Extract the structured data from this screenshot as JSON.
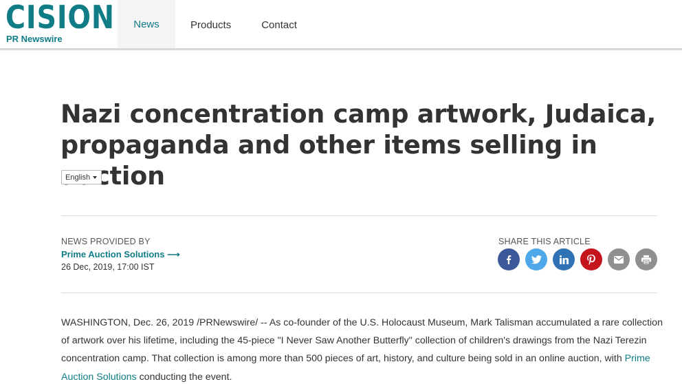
{
  "header": {
    "logo": {
      "word": "CISION",
      "registered": "®",
      "sub": "PR Newswire"
    },
    "nav": [
      {
        "label": "News",
        "active": true
      },
      {
        "label": "Products",
        "active": false
      },
      {
        "label": "Contact",
        "active": false
      }
    ]
  },
  "article": {
    "title": "Nazi concentration camp artwork, Judaica, propaganda and other items selling in auction",
    "language": "English",
    "provided_label": "NEWS PROVIDED BY",
    "provider": "Prime Auction Solutions",
    "provider_arrow": "⟶",
    "date": "26 Dec, 2019, 17:00 IST",
    "body_before": "WASHINGTON, Dec. 26, 2019 /PRNewswire/ -- As co-founder of the U.S. Holocaust Museum, Mark Talisman accumulated a rare collection of artwork over his lifetime, including the 45-piece \"I Never Saw Another Butterfly\" collection of children's drawings from the Nazi Terezin concentration camp. That collection is among more than 500 pieces of art, history, and culture being sold in an online auction, with ",
    "body_link": "Prime Auction Solutions",
    "body_after": " conducting the event."
  },
  "share": {
    "label": "SHARE THIS ARTICLE",
    "buttons": [
      {
        "icon": "facebook-icon",
        "color": "#3b5998"
      },
      {
        "icon": "twitter-icon",
        "color": "#4da7e8"
      },
      {
        "icon": "linkedin-icon",
        "color": "#2f73b4"
      },
      {
        "icon": "pinterest-icon",
        "color": "#c4151f"
      },
      {
        "icon": "email-icon",
        "color": "#8f8f8f"
      },
      {
        "icon": "print-icon",
        "color": "#8f8f8f"
      }
    ]
  },
  "colors": {
    "brand": "#0f7c86",
    "text": "#333333",
    "rule": "#dcdcdc"
  }
}
